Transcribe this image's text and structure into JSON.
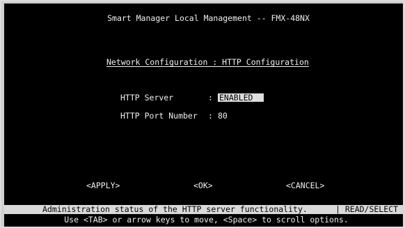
{
  "header": {
    "title": "Smart Manager Local Management -- FMX-48NX",
    "subtitle": "Network Configuration : HTTP Configuration"
  },
  "fields": [
    {
      "label": "HTTP Server",
      "separator": ":",
      "value": "ENABLED"
    },
    {
      "label": "HTTP Port Number",
      "separator": ":",
      "value": "80"
    }
  ],
  "actions": {
    "apply": "<APPLY>",
    "ok": "<OK>",
    "cancel": "<CANCEL>"
  },
  "status": {
    "message": "Administration status of the HTTP server functionality.",
    "mode": "| READ/SELECT"
  },
  "hint": "Use <TAB> or arrow keys to move, <Space> to scroll options.",
  "colors": {
    "screen_bg": "#000000",
    "text": "#f0f0f0",
    "highlight_bg": "#dedede",
    "statusbar_bg": "#d9d9d9"
  }
}
